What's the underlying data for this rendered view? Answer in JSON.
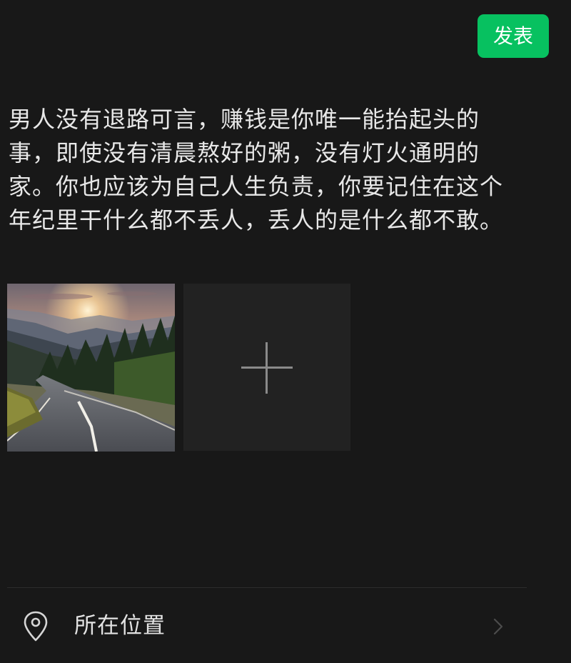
{
  "header": {
    "publish_label": "发表"
  },
  "post": {
    "lines": [
      "男人没有退路可言，赚钱是你唯一能抬起头的",
      "事，即使没有清晨熬好的粥，没有灯火通明的",
      "家。你也应该为自己人生负责，你要记住在这个",
      "年纪里干什么都不丢人，丢人的是什么都不敢。"
    ]
  },
  "media": {
    "images": [
      {
        "icon": "sunset-mountain-road-photo"
      }
    ],
    "add_icon": "plus-icon"
  },
  "location": {
    "icon": "location-pin-icon",
    "label": "所在位置",
    "chevron": "chevron-right-icon"
  },
  "colors": {
    "background": "#181818",
    "accent": "#07c160",
    "tile": "#222222"
  }
}
